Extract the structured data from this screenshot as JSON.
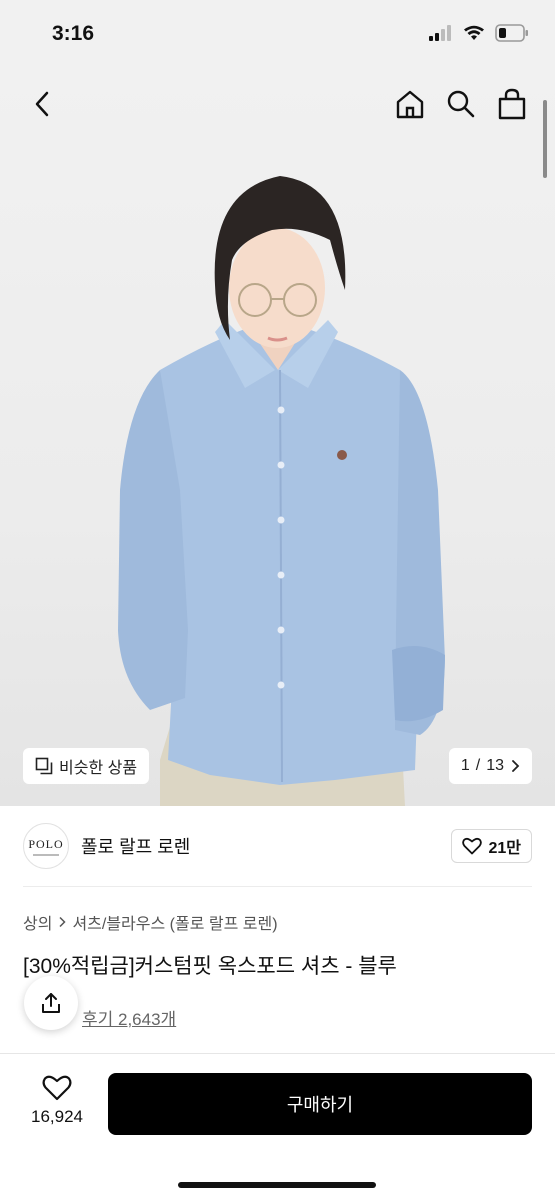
{
  "status": {
    "time": "3:16"
  },
  "nav": {
    "back_icon": "chevron-left-icon",
    "home_icon": "home-icon",
    "search_icon": "search-icon",
    "bag_icon": "shopping-bag-icon"
  },
  "gallery": {
    "similar_label": "비슷한 상품",
    "page_current": "1",
    "page_total": "13",
    "page_separator": "/"
  },
  "brand": {
    "logo_text": "POLO",
    "name": "폴로 랄프 로렌",
    "likes": "21만"
  },
  "breadcrumb": {
    "category": "상의",
    "subcategory": "셔츠/블라우스 (폴로 랄프 로렌)"
  },
  "product": {
    "title": "[30%적립금]커스텀핏 옥스포드 셔츠 - 블루",
    "reviews": "후기 2,643개"
  },
  "bottom": {
    "wish_count": "16,924",
    "buy_label": "구매하기"
  },
  "colors": {
    "shirt": "#a9c3e3",
    "buy_button": "#000000",
    "hair": "#2b2523"
  }
}
